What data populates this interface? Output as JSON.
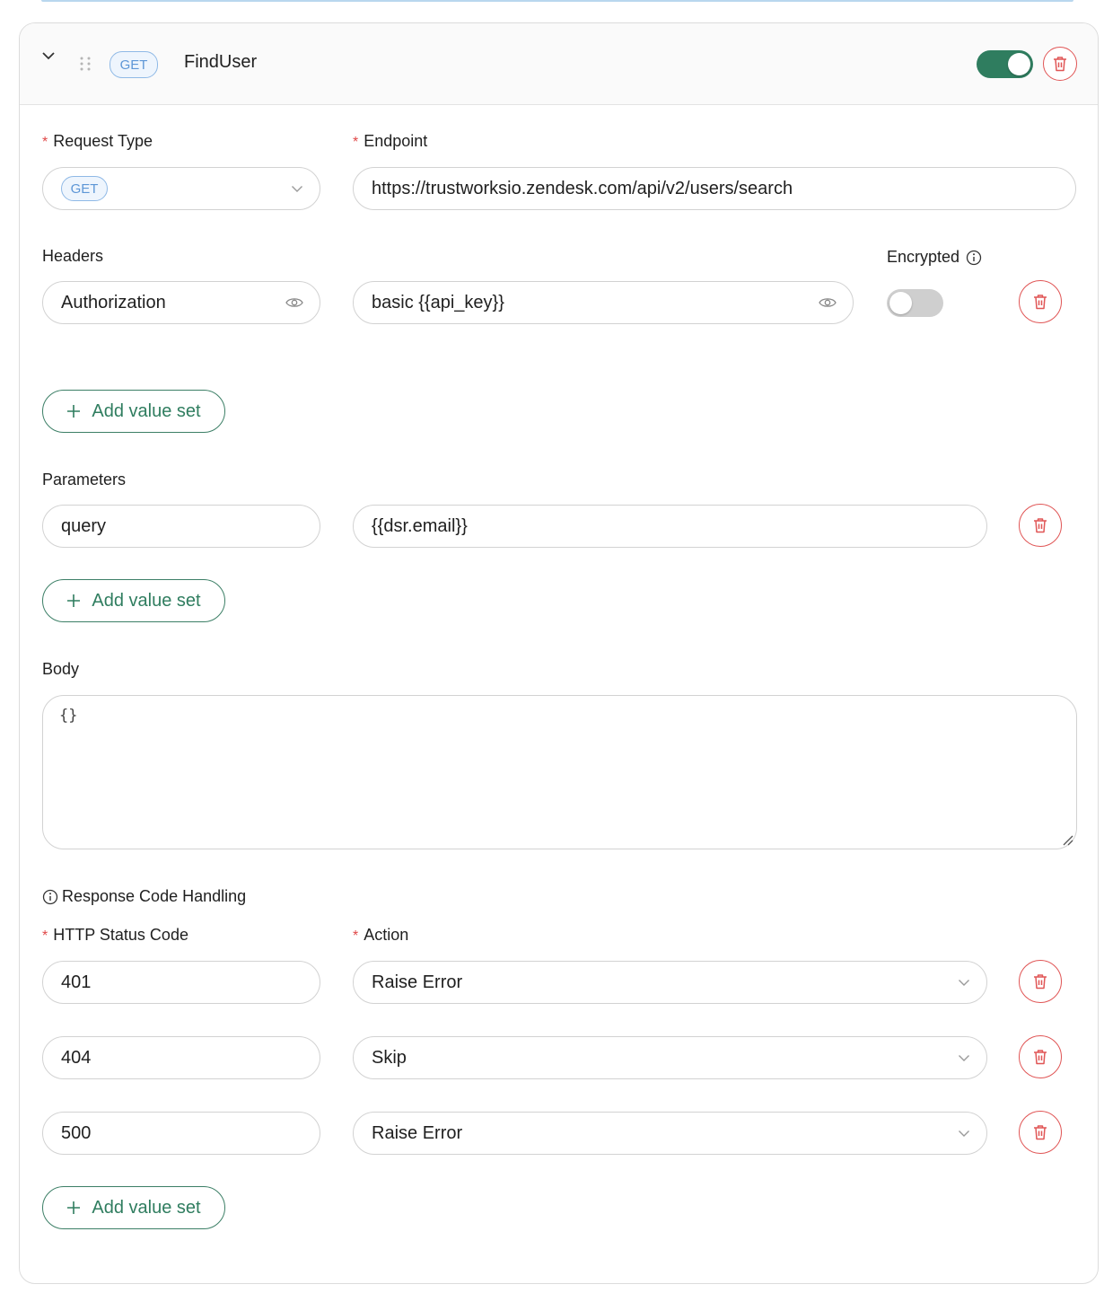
{
  "step": {
    "method": "GET",
    "name": "FindUser",
    "enabled": true
  },
  "request_type": {
    "label": "Request Type",
    "value": "GET"
  },
  "endpoint": {
    "label": "Endpoint",
    "value": "https://trustworksio.zendesk.com/api/v2/users/search"
  },
  "headers": {
    "label": "Headers",
    "encrypted_label": "Encrypted",
    "rows": [
      {
        "key": "Authorization",
        "value": "basic {{api_key}}",
        "encrypted": false
      }
    ],
    "add_label": "Add value set"
  },
  "parameters": {
    "label": "Parameters",
    "rows": [
      {
        "key": "query",
        "value": "{{dsr.email}}"
      }
    ],
    "add_label": "Add value set"
  },
  "body": {
    "label": "Body",
    "value": "{}"
  },
  "response_handling": {
    "title": "Response Code Handling",
    "status_label": "HTTP Status Code",
    "action_label": "Action",
    "rows": [
      {
        "code": "401",
        "action": "Raise Error"
      },
      {
        "code": "404",
        "action": "Skip"
      },
      {
        "code": "500",
        "action": "Raise Error"
      }
    ],
    "add_label": "Add value set"
  },
  "colors": {
    "accent_green": "#2f7d5f",
    "danger_red": "#e05555",
    "method_blue": "#5d96d6",
    "required_red": "#e04848"
  }
}
